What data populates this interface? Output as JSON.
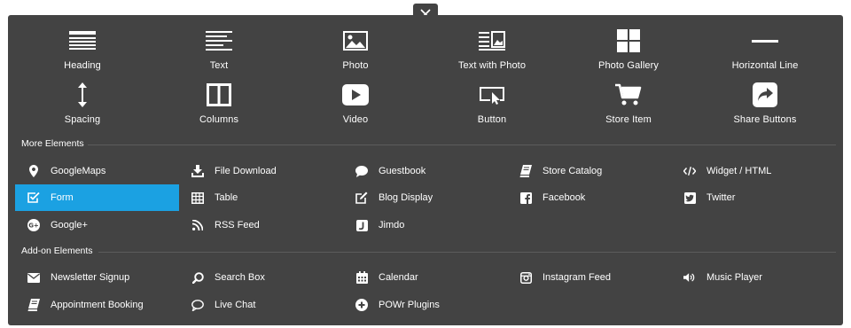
{
  "close_button": {
    "glyph": "✕"
  },
  "basic_elements": [
    {
      "icon": "heading-icon",
      "label": "Heading"
    },
    {
      "icon": "text-icon",
      "label": "Text"
    },
    {
      "icon": "photo-icon",
      "label": "Photo"
    },
    {
      "icon": "text-with-photo-icon",
      "label": "Text with Photo"
    },
    {
      "icon": "photo-gallery-icon",
      "label": "Photo Gallery"
    },
    {
      "icon": "horizontal-line-icon",
      "label": "Horizontal Line"
    },
    {
      "icon": "spacing-icon",
      "label": "Spacing"
    },
    {
      "icon": "columns-icon",
      "label": "Columns"
    },
    {
      "icon": "video-icon",
      "label": "Video"
    },
    {
      "icon": "button-icon",
      "label": "Button"
    },
    {
      "icon": "store-item-icon",
      "label": "Store Item"
    },
    {
      "icon": "share-buttons-icon",
      "label": "Share Buttons"
    }
  ],
  "more_elements": {
    "title": "More Elements",
    "items": [
      {
        "icon": "map-pin-icon",
        "label": "GoogleMaps"
      },
      {
        "icon": "download-icon",
        "label": "File Download"
      },
      {
        "icon": "speech-bubble-icon",
        "label": "Guestbook"
      },
      {
        "icon": "book-icon",
        "label": "Store Catalog"
      },
      {
        "icon": "code-icon",
        "label": "Widget / HTML"
      },
      {
        "icon": "checkbox-icon",
        "label": "Form",
        "active": true
      },
      {
        "icon": "table-icon",
        "label": "Table"
      },
      {
        "icon": "edit-icon",
        "label": "Blog Display"
      },
      {
        "icon": "facebook-icon",
        "label": "Facebook"
      },
      {
        "icon": "twitter-icon",
        "label": "Twitter"
      },
      {
        "icon": "google-plus-icon",
        "label": "Google+"
      },
      {
        "icon": "rss-icon",
        "label": "RSS Feed"
      },
      {
        "icon": "jimdo-icon",
        "label": "Jimdo"
      }
    ]
  },
  "addon_elements": {
    "title": "Add-on Elements",
    "items": [
      {
        "icon": "envelope-icon",
        "label": "Newsletter Signup"
      },
      {
        "icon": "search-icon",
        "label": "Search Box"
      },
      {
        "icon": "calendar-icon",
        "label": "Calendar"
      },
      {
        "icon": "instagram-icon",
        "label": "Instagram Feed"
      },
      {
        "icon": "speaker-icon",
        "label": "Music Player"
      },
      {
        "icon": "appointment-book-icon",
        "label": "Appointment Booking"
      },
      {
        "icon": "chat-bubble-icon",
        "label": "Live Chat"
      },
      {
        "icon": "plus-circle-icon",
        "label": "POWr Plugins"
      }
    ]
  },
  "colors": {
    "panel_bg": "#434343",
    "active_bg": "#1ba1e2",
    "text": "#ffffff"
  }
}
